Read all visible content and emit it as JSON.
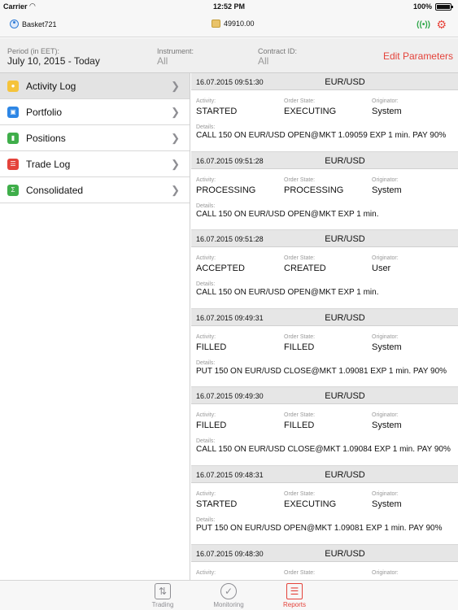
{
  "status_bar": {
    "carrier": "Carrier",
    "time": "12:52 PM",
    "battery": "100%",
    "battery_level": 1.0
  },
  "header": {
    "account": "Basket721",
    "balance": "49910.00",
    "colors": {
      "signal": "#2fa74a",
      "accent": "#e4433b"
    },
    "icons": [
      "user-icon",
      "coins-icon",
      "signal-icon",
      "gear-icon"
    ]
  },
  "filters": {
    "period_label": "Period (in EET):",
    "period_value": "July 10, 2015 - Today",
    "instrument_label": "Instrument:",
    "instrument_value": "All",
    "contract_label": "Contract ID:",
    "contract_value": "All",
    "edit_label": "Edit Parameters"
  },
  "sidebar": {
    "items": [
      {
        "label": "Activity Log",
        "icon": "activity-log-icon",
        "color": "#f5c33b",
        "selected": true
      },
      {
        "label": "Portfolio",
        "icon": "portfolio-icon",
        "color": "#2d86e5",
        "selected": false
      },
      {
        "label": "Positions",
        "icon": "positions-icon",
        "color": "#3fae4a",
        "selected": false
      },
      {
        "label": "Trade Log",
        "icon": "trade-log-icon",
        "color": "#e4433b",
        "selected": false
      },
      {
        "label": "Consolidated",
        "icon": "consolidated-icon",
        "color": "#3fae4a",
        "selected": false
      }
    ]
  },
  "field_labels": {
    "activity": "Activity:",
    "order_state": "Order State:",
    "originator": "Originator:",
    "details": "Details:"
  },
  "log": {
    "entries": [
      {
        "time": "16.07.2015 09:51:30",
        "instrument": "EUR/USD",
        "activity": "STARTED",
        "order_state": "EXECUTING",
        "originator": "System",
        "details": "CALL 150 ON EUR/USD OPEN@MKT 1.09059 EXP 1 min. PAY 90%"
      },
      {
        "time": "16.07.2015 09:51:28",
        "instrument": "EUR/USD",
        "activity": "PROCESSING",
        "order_state": "PROCESSING",
        "originator": "System",
        "details": "CALL 150 ON EUR/USD OPEN@MKT EXP 1 min."
      },
      {
        "time": "16.07.2015 09:51:28",
        "instrument": "EUR/USD",
        "activity": "ACCEPTED",
        "order_state": "CREATED",
        "originator": "User",
        "details": "CALL 150 ON EUR/USD OPEN@MKT EXP 1 min."
      },
      {
        "time": "16.07.2015 09:49:31",
        "instrument": "EUR/USD",
        "activity": "FILLED",
        "order_state": "FILLED",
        "originator": "System",
        "details": "PUT 150 ON EUR/USD CLOSE@MKT 1.09081 EXP 1 min. PAY 90%"
      },
      {
        "time": "16.07.2015 09:49:30",
        "instrument": "EUR/USD",
        "activity": "FILLED",
        "order_state": "FILLED",
        "originator": "System",
        "details": "CALL 150 ON EUR/USD CLOSE@MKT 1.09084 EXP 1 min. PAY 90%"
      },
      {
        "time": "16.07.2015 09:48:31",
        "instrument": "EUR/USD",
        "activity": "STARTED",
        "order_state": "EXECUTING",
        "originator": "System",
        "details": "PUT 150 ON EUR/USD OPEN@MKT 1.09081 EXP 1 min. PAY 90%"
      },
      {
        "time": "16.07.2015 09:48:30",
        "instrument": "EUR/USD",
        "activity": "",
        "order_state": "",
        "originator": "",
        "details": ""
      }
    ]
  },
  "tabbar": {
    "tabs": [
      {
        "label": "Trading",
        "icon": "trading-icon",
        "active": false
      },
      {
        "label": "Monitoring",
        "icon": "monitoring-icon",
        "active": false
      },
      {
        "label": "Reports",
        "icon": "reports-icon",
        "active": true
      }
    ]
  }
}
